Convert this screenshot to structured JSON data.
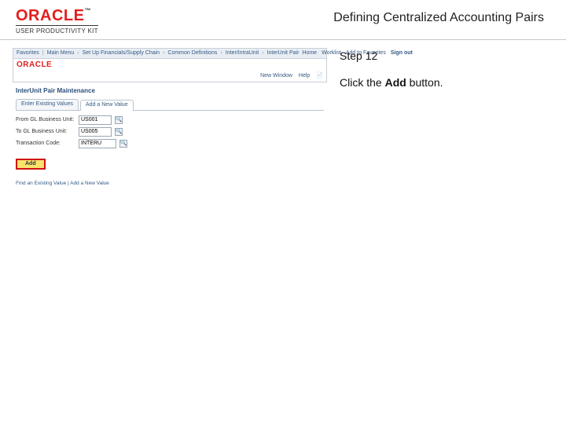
{
  "header": {
    "brand_main": "ORACLE",
    "brand_tm": "™",
    "brand_sub": "USER PRODUCTIVITY KIT",
    "title": "Defining Centralized Accounting Pairs"
  },
  "instruction": {
    "step_label": "Step 12",
    "body_prefix": "Click the ",
    "body_bold": "Add",
    "body_suffix": " button."
  },
  "app": {
    "nav": {
      "item1": "Favorites",
      "item2": "Main Menu",
      "item3": "Set Up Financials/Supply Chain",
      "item4": "Common Definitions",
      "item5": "Inter/IntraUnit",
      "item6": "InterUnit Pair"
    },
    "topright": {
      "home": "Home",
      "worklist": "Worklist",
      "addfav": "Add to Favorites",
      "signout": "Sign out"
    },
    "logo": "ORACLE",
    "subbar": {
      "newwin": "New Window",
      "help": "Help"
    },
    "page_title": "InterUnit Pair Maintenance",
    "tabs": {
      "t1": "Enter Existing Values",
      "t2": "Add a New Value"
    },
    "fields": {
      "f1_label": "From GL Business Unit:",
      "f1_value": "US001",
      "f2_label": "To GL Business Unit:",
      "f2_value": "US005",
      "f3_label": "Transaction Code:",
      "f3_value": "INTERU"
    },
    "add_label": "Add",
    "footer": "Find an Existing Value | Add a New Value"
  }
}
